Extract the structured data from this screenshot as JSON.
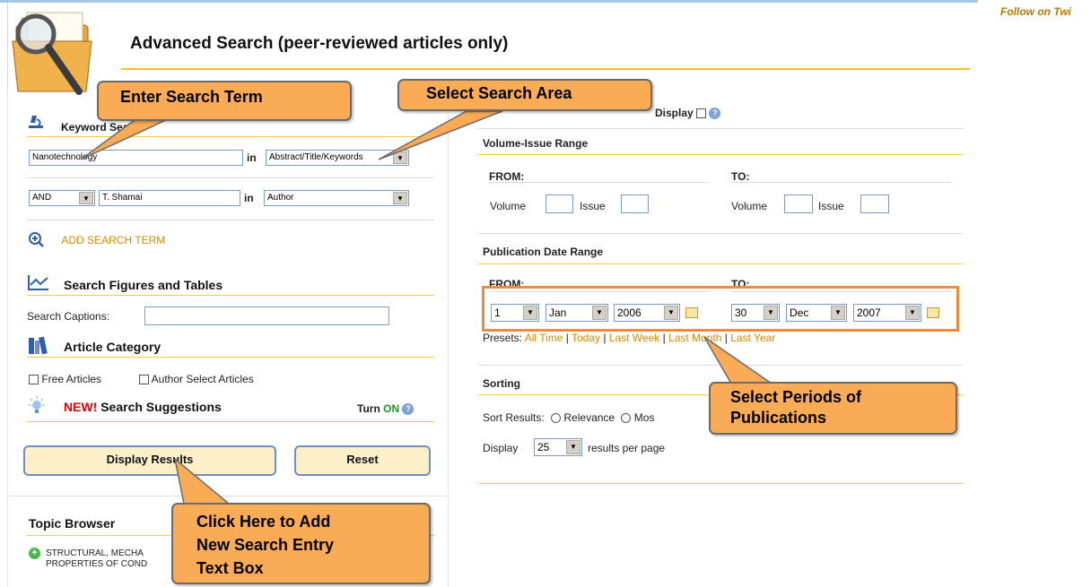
{
  "page": {
    "title": "Advanced Search (peer-reviewed articles only)",
    "follow_link": "Follow on Twi"
  },
  "keyword_search": {
    "header": "Keyword Search",
    "row1": {
      "term": "Nanotechnology",
      "in_label": "in",
      "area": "Abstract/Title/Keywords"
    },
    "row2": {
      "operator": "AND",
      "term": "T. Shamai",
      "in_label": "in",
      "area": "Author"
    },
    "add_term_label": "ADD SEARCH TERM"
  },
  "figures": {
    "header": "Search Figures and Tables",
    "captions_label": "Search Captions:",
    "captions_value": ""
  },
  "category": {
    "header": "Article Category",
    "free_label": "Free Articles",
    "author_select_label": "Author Select Articles"
  },
  "suggestions": {
    "new_label": "NEW!",
    "header": "Search Suggestions",
    "turn_label": "Turn",
    "on_label": "ON"
  },
  "buttons": {
    "display": "Display Results",
    "reset": "Reset"
  },
  "topic_browser": {
    "header": "Topic Browser",
    "item_line1": "STRUCTURAL, MECHA",
    "item_line2": "PROPERTIES OF COND"
  },
  "right": {
    "display_label": "Display",
    "volume_issue": {
      "header": "Volume-Issue Range",
      "from": "FROM:",
      "to": "TO:",
      "volume_label": "Volume",
      "issue_label": "Issue"
    },
    "pub_date": {
      "header": "Publication Date Range",
      "from": "FROM:",
      "to": "TO:",
      "from_day": "1",
      "from_month": "Jan",
      "from_year": "2006",
      "to_day": "30",
      "to_month": "Dec",
      "to_year": "2007",
      "presets_label": "Presets:",
      "presets": [
        "All Time",
        "Today",
        "Last Week",
        "Last Month",
        "Last Year"
      ]
    },
    "sorting": {
      "header": "Sorting",
      "sort_label": "Sort Results:",
      "relevance": "Relevance",
      "most": "Mos",
      "display_label": "Display",
      "per_page_value": "25",
      "per_page_suffix": "results per page"
    }
  },
  "callouts": {
    "enter_term": "Enter Search Term",
    "select_area": "Select Search Area",
    "select_periods_1": "Select Periods of",
    "select_periods_2": "Publications",
    "click_here_1": "Click Here to Add",
    "click_here_2": "New Search Entry",
    "click_here_3": "Text Box"
  },
  "colors": {
    "accent_orange": "#d68a00",
    "callout_fill": "#f9ab55",
    "rule_yellow": "#ffc21a",
    "highlight_box": "#f08a3c",
    "on_green": "#1a9a1a",
    "new_red": "#e00000"
  }
}
